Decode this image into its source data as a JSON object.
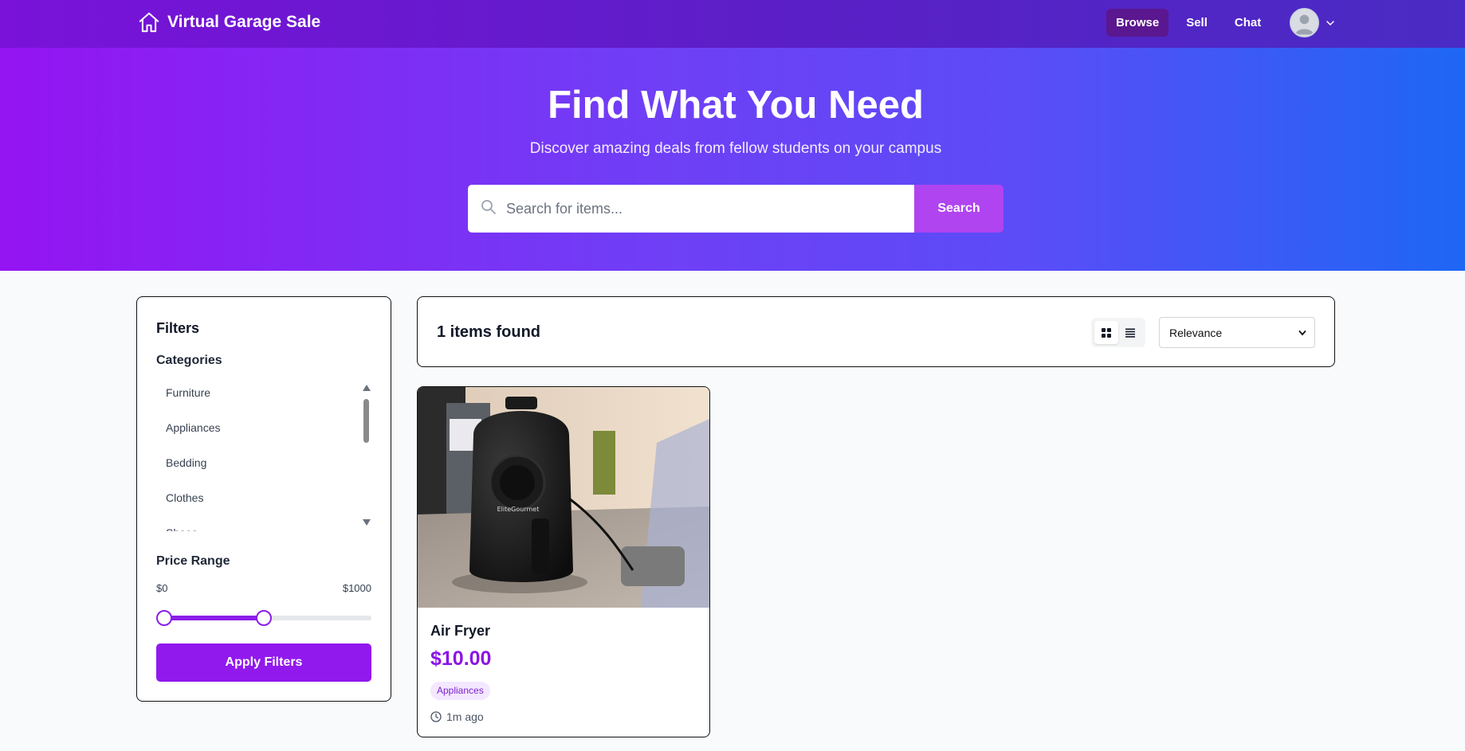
{
  "nav": {
    "brand": "Virtual Garage Sale",
    "links": [
      {
        "label": "Browse",
        "active": true
      },
      {
        "label": "Sell",
        "active": false
      },
      {
        "label": "Chat",
        "active": false
      }
    ]
  },
  "hero": {
    "title": "Find What You Need",
    "subtitle": "Discover amazing deals from fellow students on your campus",
    "search_placeholder": "Search for items...",
    "search_button": "Search"
  },
  "filters": {
    "title": "Filters",
    "categories_title": "Categories",
    "categories": [
      "Furniture",
      "Appliances",
      "Bedding",
      "Clothes",
      "Shoes"
    ],
    "price_title": "Price Range",
    "price_min_label": "$0",
    "price_max_label": "$1000",
    "price_slider_low": 0,
    "price_slider_high": 500,
    "apply_button": "Apply Filters"
  },
  "results": {
    "count_text": "1 items found",
    "sort_selected": "Relevance",
    "view_mode": "grid"
  },
  "items": [
    {
      "title": "Air Fryer",
      "price": "$10.00",
      "category": "Appliances",
      "posted": "1m ago",
      "image_label": "EliteGourmet"
    }
  ],
  "colors": {
    "accent": "#8b14e6",
    "hero_start": "#9414f2",
    "hero_end": "#1e67f5",
    "search_button": "#b044f0"
  }
}
